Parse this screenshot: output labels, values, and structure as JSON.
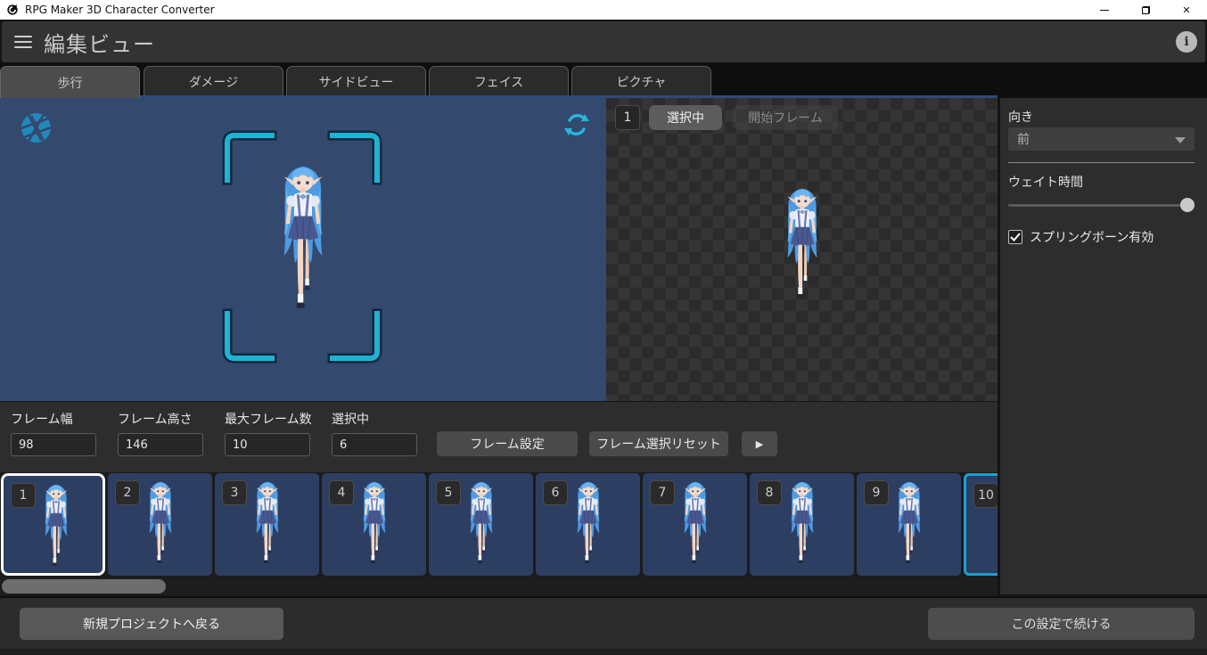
{
  "window": {
    "title": "RPG Maker 3D Character Converter",
    "minimize_glyph": "─",
    "close_glyph": "✕"
  },
  "header": {
    "title": "編集ビュー",
    "info_glyph": "i"
  },
  "tabs": [
    {
      "label": "歩行",
      "active": true
    },
    {
      "label": "ダメージ",
      "active": false
    },
    {
      "label": "サイドビュー",
      "active": false
    },
    {
      "label": "フェイス",
      "active": false
    },
    {
      "label": "ピクチャ",
      "active": false
    }
  ],
  "preview_panel": {
    "frame_badge": "1",
    "selected_chip": "選択中",
    "start_frame_chip": "開始フレーム"
  },
  "right_panel": {
    "direction_label": "向き",
    "direction_value": "前",
    "wait_label": "ウェイト時間",
    "springbone_label": "スプリングボーン有効",
    "springbone_checked": true
  },
  "frame_controls": {
    "fields": [
      {
        "label": "フレーム幅",
        "value": "98"
      },
      {
        "label": "フレーム高さ",
        "value": "146"
      },
      {
        "label": "最大フレーム数",
        "value": "10"
      },
      {
        "label": "選択中",
        "value": "6"
      }
    ],
    "frame_set_button": "フレーム設定",
    "frame_reset_button": "フレーム選択リセット",
    "play_button": "▶"
  },
  "filmstrip": {
    "frames": [
      {
        "num": "1",
        "state": "selected"
      },
      {
        "num": "2",
        "state": "normal"
      },
      {
        "num": "3",
        "state": "normal"
      },
      {
        "num": "4",
        "state": "normal"
      },
      {
        "num": "5",
        "state": "normal"
      },
      {
        "num": "6",
        "state": "normal"
      },
      {
        "num": "7",
        "state": "normal"
      },
      {
        "num": "8",
        "state": "normal"
      },
      {
        "num": "9",
        "state": "normal"
      },
      {
        "num": "10",
        "state": "highlight"
      }
    ]
  },
  "footer": {
    "back_button": "新規プロジェクトへ戻る",
    "continue_button": "この設定で続ける"
  },
  "colors": {
    "accent_cyan": "#1fb3d2",
    "preview_bg": "#34496e",
    "frame_card_bg": "#2d3e63",
    "selected_frame_border": "#ffffff",
    "highlight_frame_border": "#1a9fd4"
  }
}
